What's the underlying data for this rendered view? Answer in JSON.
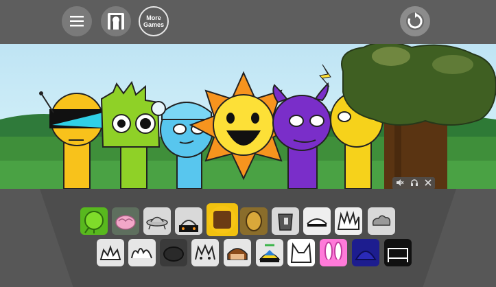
{
  "topbar": {
    "menu_icon": "hamburger-icon",
    "character_icon": "character-portrait-icon",
    "more_games_label_1": "More",
    "more_games_label_2": "Games",
    "reset_icon": "reset-icon"
  },
  "audio_controls": {
    "mute_icon": "mute-icon",
    "headphones_icon": "headphones-icon",
    "close_icon": "close-icon"
  },
  "colors": {
    "topbar": "#5e5e5e",
    "panel": "#4d4d4d",
    "grass": "#3f8f3a",
    "orange_char": "#f8c21b",
    "green_char": "#8fd127",
    "blue_char": "#58c6ee",
    "sun": "#f7941e",
    "purple_char": "#7a2ec9",
    "yellow_char": "#f6d21b"
  },
  "sound_icons_row1": [
    "green-orb-icon",
    "brain-icon",
    "ufo-hat-icon",
    "headphones-hat-icon",
    "sunflower-icon",
    "egg-icon",
    "bucket-icon",
    "visor-icon",
    "spiky-hair-icon",
    "cloud-hat-icon"
  ],
  "sound_icons_row2": [
    "crown-hair-icon",
    "messy-hair-icon",
    "dark-blob-icon",
    "swirl-hair-icon",
    "brown-hair-icon",
    "propeller-cap-icon",
    "cat-ears-icon",
    "pink-bunny-icon",
    "blue-dome-icon",
    "black-band-icon"
  ]
}
